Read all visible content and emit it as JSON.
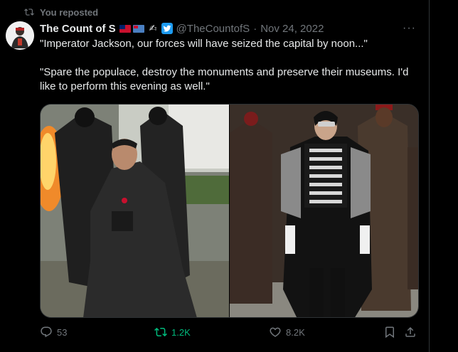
{
  "repost": {
    "label": "You reposted"
  },
  "tweet": {
    "display_name": "The Count of S",
    "handle": "@TheCountofS",
    "separator": "·",
    "date": "Nov 24, 2022",
    "more": "···",
    "paragraphs": [
      "\"Imperator Jackson, our forces will have seized the capital by noon...\"",
      "\"Spare the populace, destroy the monuments and preserve their museums. I'd like to perform this evening as well.\""
    ]
  },
  "stats": {
    "replies": "53",
    "reposts": "1.2K",
    "likes": "8.2K"
  },
  "colors": {
    "background": "#000000",
    "text": "#e7e9ea",
    "muted": "#71767b",
    "repost_active": "#00ba7c",
    "verified_blue": "#1d9bf0"
  },
  "icons": {
    "repost": "repost-icon",
    "reply": "reply-icon",
    "like": "heart-icon",
    "bookmark": "bookmark-icon",
    "share": "share-icon",
    "more": "more-icon",
    "twitter": "twitter-bird-icon"
  }
}
